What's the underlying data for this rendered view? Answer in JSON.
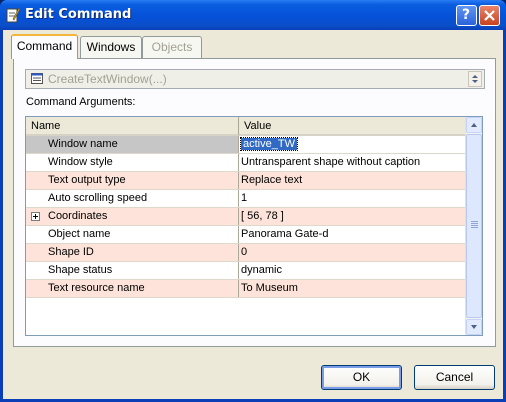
{
  "window": {
    "title": "Edit Command",
    "help_label": "?",
    "close_icon": "close-icon"
  },
  "tabs": [
    {
      "label": "Command",
      "state": "active"
    },
    {
      "label": "Windows",
      "state": "normal"
    },
    {
      "label": "Objects",
      "state": "disabled"
    }
  ],
  "command": {
    "selected": "CreateTextWindow(...)"
  },
  "arguments": {
    "label": "Command Arguments:",
    "columns": [
      "Name",
      "Value"
    ],
    "rows": [
      {
        "name": "Window name",
        "value": "active_TW"
      },
      {
        "name": "Window style",
        "value": "Untransparent shape without caption"
      },
      {
        "name": "Text output type",
        "value": "Replace text"
      },
      {
        "name": "Auto scrolling speed",
        "value": "1"
      },
      {
        "name": "Coordinates",
        "value": "[ 56, 78 ]"
      },
      {
        "name": "Object name",
        "value": "Panorama Gate-d"
      },
      {
        "name": "Shape ID",
        "value": "0"
      },
      {
        "name": "Shape status",
        "value": "dynamic"
      },
      {
        "name": "Text resource name",
        "value": "To Museum"
      }
    ]
  },
  "buttons": {
    "ok": "OK",
    "cancel": "Cancel"
  },
  "colors": {
    "title_bar": "#0551d8",
    "row_highlight": "#fde3d9",
    "selection": "#316ac5"
  }
}
